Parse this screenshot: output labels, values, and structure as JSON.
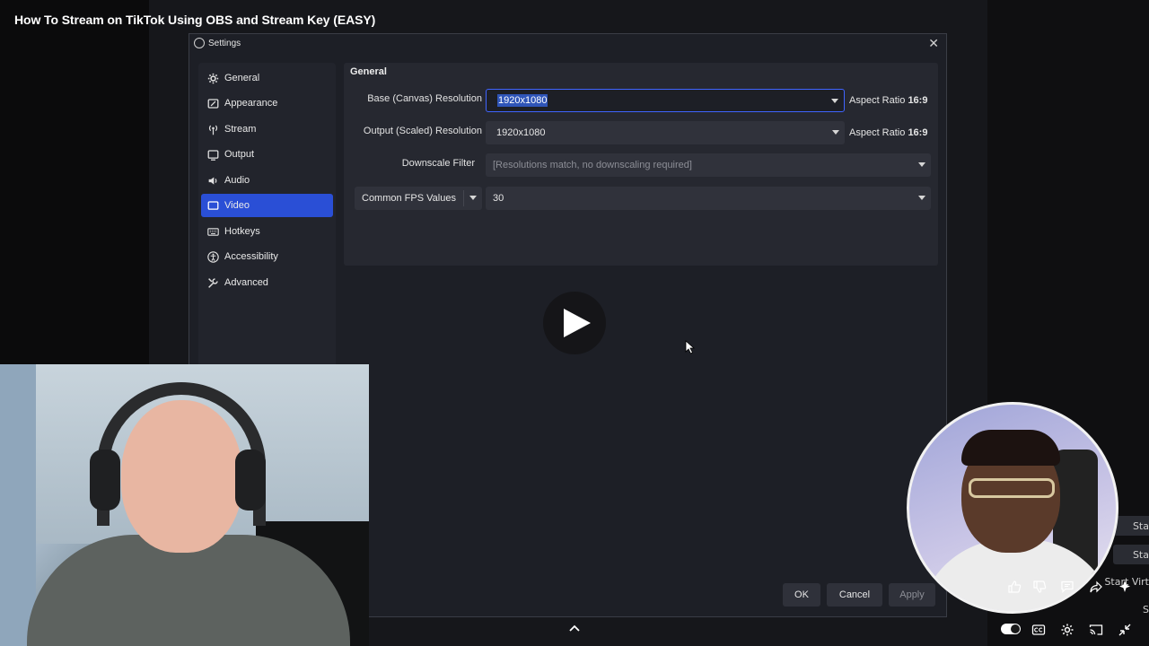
{
  "video": {
    "title": "How To Stream on TikTok Using OBS and Stream Key (EASY)"
  },
  "dialog": {
    "title": "Settings",
    "sidebar": {
      "items": [
        {
          "label": "General",
          "icon": "gear-icon"
        },
        {
          "label": "Appearance",
          "icon": "appearance-icon"
        },
        {
          "label": "Stream",
          "icon": "broadcast-icon"
        },
        {
          "label": "Output",
          "icon": "output-icon"
        },
        {
          "label": "Audio",
          "icon": "speaker-icon"
        },
        {
          "label": "Video",
          "icon": "monitor-icon",
          "active": true
        },
        {
          "label": "Hotkeys",
          "icon": "keyboard-icon"
        },
        {
          "label": "Accessibility",
          "icon": "accessibility-icon"
        },
        {
          "label": "Advanced",
          "icon": "wrench-icon"
        }
      ]
    },
    "section_title": "General",
    "base_resolution": {
      "label": "Base (Canvas) Resolution",
      "value": "1920x1080",
      "aspect_label": "Aspect Ratio",
      "aspect_value": "16:9"
    },
    "output_resolution": {
      "label": "Output (Scaled) Resolution",
      "value": "1920x1080",
      "aspect_label": "Aspect Ratio",
      "aspect_value": "16:9"
    },
    "downscale_filter": {
      "label": "Downscale Filter",
      "value": "[Resolutions match, no downscaling required]"
    },
    "fps": {
      "type_label": "Common FPS Values",
      "value": "30"
    },
    "buttons": {
      "ok": "OK",
      "cancel": "Cancel",
      "apply": "Apply"
    }
  },
  "obs_sidebar_fragments": [
    "Sta",
    "Sta",
    "Start Virt",
    "S"
  ],
  "colors": {
    "accent": "#2a4fd6",
    "dialog_bg": "#1d1f26",
    "panel_bg": "#262830"
  }
}
